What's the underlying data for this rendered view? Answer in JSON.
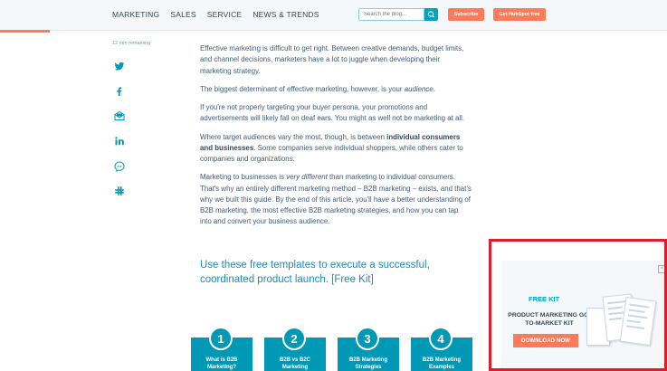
{
  "nav": {
    "items": [
      "MARKETING",
      "SALES",
      "SERVICE",
      "NEWS & TRENDS"
    ]
  },
  "search": {
    "placeholder": "Search the blog..."
  },
  "buttons": {
    "subscribe": "Subscribe",
    "get_hubspot": "Get HubSpot free"
  },
  "article": {
    "time_remaining": "12 min remaining",
    "p1": "Effective marketing is difficult to get right. Between creative demands, budget limits, and channel decisions, marketers have a lot to juggle when developing their marketing strategy.",
    "p2_a": "The biggest determinant of effective marketing, however, is your ",
    "p2_em": "audience",
    "p2_b": ".",
    "p3": "If you're not properly targeting your buyer persona, your promotions and advertisements will likely fall on deaf ears. You might as well not be marketing at all.",
    "p4_a": "Where target audiences vary the most, though, is between ",
    "p4_b": "individual consumers and businesses",
    "p4_c": ". Some companies serve individual shoppers, while others cater to companies and organizations.",
    "p5_a": "Marketing to businesses is ",
    "p5_em": "very different",
    "p5_b": " than marketing to individual consumers. That's why an entirely different marketing method – B2B marketing – exists, and that's why we built this guide. By the end of this article, you'll have a better understanding of B2B marketing, the most effective B2B marketing strategies, and how you can tap into and convert your business audience.",
    "cta": "Use these free templates to execute a successful, coordinated product launch. [Free Kit]"
  },
  "cards": [
    {
      "num": "1",
      "label": "What is B2B Marketing?"
    },
    {
      "num": "2",
      "label": "B2B vs B2C Marketing"
    },
    {
      "num": "3",
      "label": "B2B Marketing Strategies"
    },
    {
      "num": "4",
      "label": "B2B Marketing Examples"
    }
  ],
  "ad": {
    "close": "×",
    "free_kit": "FREE KIT",
    "title": "PRODUCT MARKETING GO-TO-MARKET KIT",
    "button": "DOWNLOAD NOW"
  },
  "share_icons": [
    "twitter-icon",
    "facebook-icon",
    "email-icon",
    "linkedin-icon",
    "messenger-icon",
    "slack-icon"
  ],
  "colors": {
    "accent": "#ff7a59",
    "teal": "#00a4bd",
    "card": "#0099b5",
    "highlight_frame": "#d8202a",
    "link": "#1d8bb5"
  }
}
